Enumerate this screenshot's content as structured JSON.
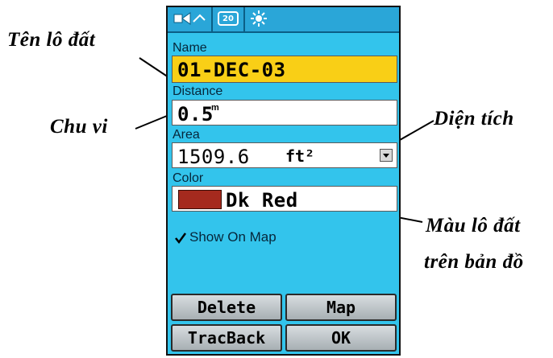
{
  "callouts": {
    "name": "Tên lô đất",
    "perimeter": "Chu vi",
    "area": "Diện tích",
    "color_line1": "Màu lô đất",
    "color_line2": "trên bản đồ"
  },
  "status_bar": {
    "icons": [
      "data-transfer-icon",
      "battery-icon",
      "backlight-icon"
    ],
    "badge": "20"
  },
  "form": {
    "name_label": "Name",
    "name_value": "01-DEC-03",
    "distance_label": "Distance",
    "distance_value": "0.5",
    "distance_unit": "m",
    "area_label": "Area",
    "area_value": "1509.6",
    "area_unit": "ft²",
    "color_label": "Color",
    "color_value": "Dk Red",
    "color_hex": "#a52a1e",
    "show_on_map_label": "Show On Map",
    "show_on_map_checked": true
  },
  "buttons": {
    "delete": "Delete",
    "map": "Map",
    "tracback": "TracBack",
    "ok": "OK"
  },
  "colors": {
    "screen_bg": "#33c4ec",
    "name_highlight": "#f9cf16"
  }
}
